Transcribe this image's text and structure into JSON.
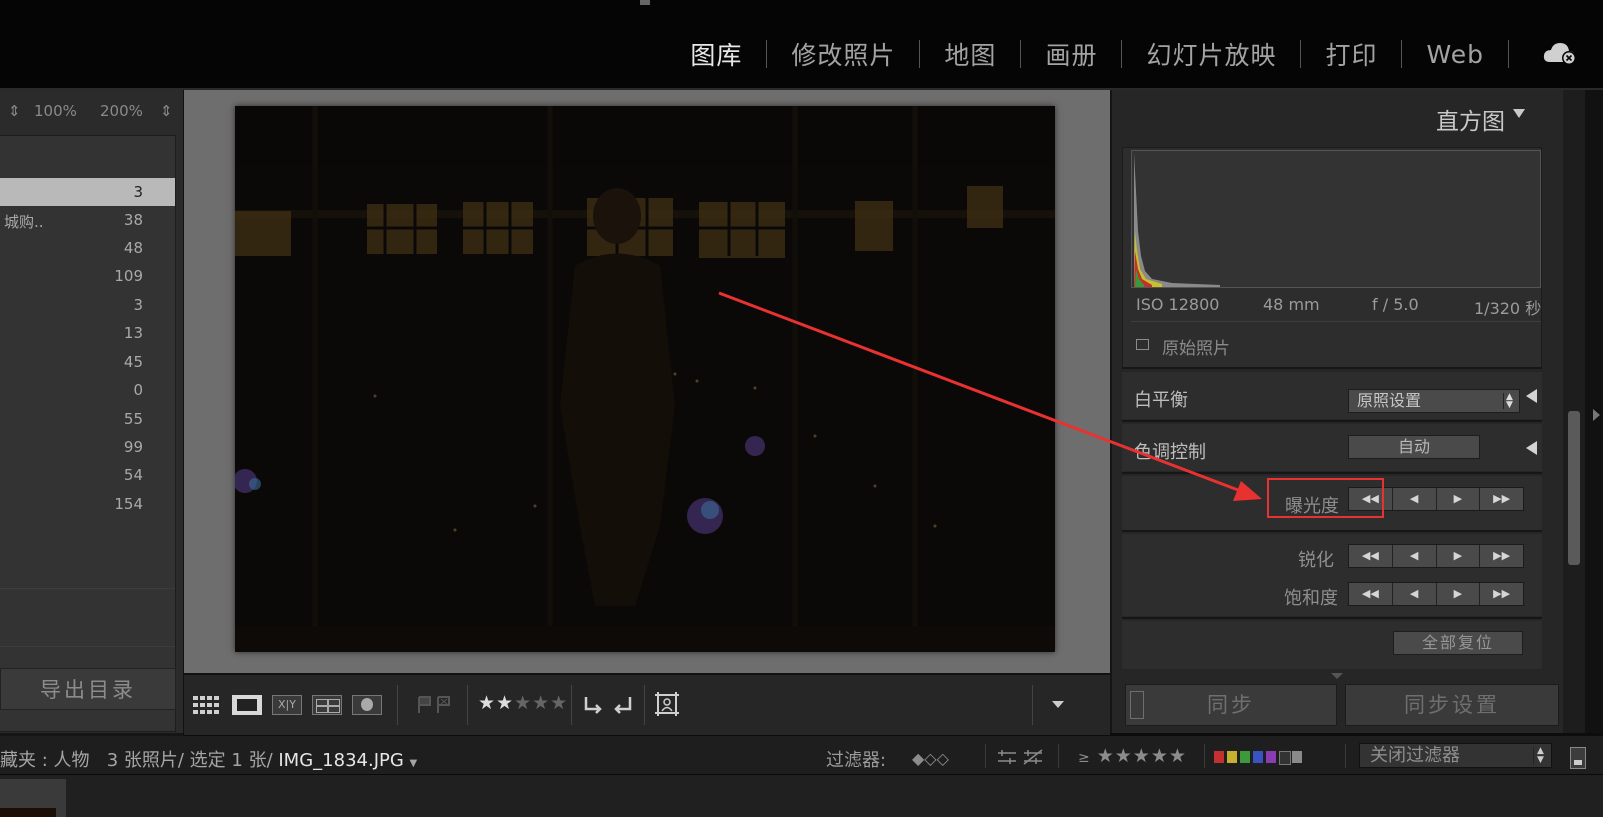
{
  "modules": [
    "图库",
    "修改照片",
    "地图",
    "画册",
    "幻灯片放映",
    "打印",
    "Web"
  ],
  "active_module": "图库",
  "left_panel": {
    "zoom_options": [
      "100%",
      "200%"
    ],
    "counts": [
      "3",
      "38",
      "48",
      "109",
      "3",
      "13",
      "45",
      "0",
      "55",
      "99",
      "54",
      "154"
    ],
    "partial_name": "城购..",
    "export_button": "导出目录"
  },
  "toolbar": {
    "rating_on": "★★",
    "rating_off": "★★★",
    "icons": [
      "grid-view-icon",
      "loupe-view-icon",
      "compare-view-icon",
      "survey-view-icon",
      "people-view-icon",
      "flag-icon",
      "reject-flag-icon",
      "rotate-left-icon",
      "rotate-right-icon",
      "crop-overlay-icon",
      "dropdown-icon"
    ]
  },
  "right_panel": {
    "histogram_title": "直方图",
    "exif": {
      "iso": "ISO 12800",
      "focal": "48 mm",
      "aperture": "f / 5.0",
      "shutter": "1/320 秒"
    },
    "original_photo": "原始照片",
    "white_balance_label": "白平衡",
    "white_balance_value": "原照设置",
    "tone_control_label": "色调控制",
    "auto_button": "自动",
    "exposure_label": "曝光度",
    "sharpen_label": "锐化",
    "saturation_label": "饱和度",
    "reset_all": "全部复位",
    "sync_button": "同步",
    "sync_settings_button": "同步设置"
  },
  "status_bar": {
    "collection": "藏夹 : 人物",
    "photo_count": "3 张照片/",
    "selected": "选定 1 张/",
    "filename": "IMG_1834.JPG",
    "filter_label": "过滤器:",
    "filter_stars": "★★★★★",
    "filter_ge": "≥",
    "filter_select": "关闭过滤器"
  },
  "colors": {
    "highlight": "#e83232",
    "swatches": [
      "#c43030",
      "#c6b030",
      "#3c9a3c",
      "#3a52c4",
      "#8a3cb4",
      "#8a8a8a"
    ]
  }
}
